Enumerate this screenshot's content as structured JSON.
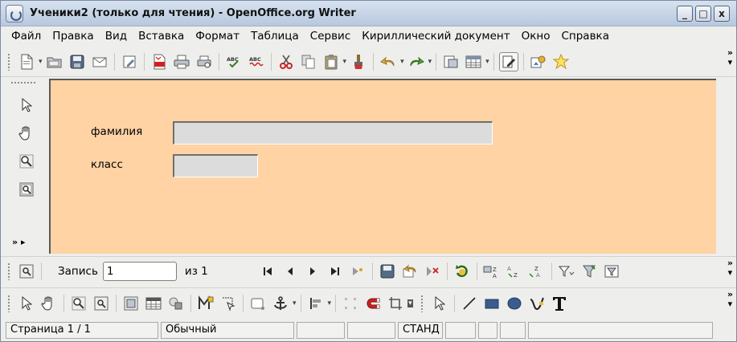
{
  "window": {
    "title": "Ученики2 (только для чтения) - OpenOffice.org Writer",
    "buttons": {
      "minimize": "_",
      "maximize": "□",
      "close": "x"
    }
  },
  "menu": [
    "Файл",
    "Правка",
    "Вид",
    "Вставка",
    "Формат",
    "Таблица",
    "Сервис",
    "Кириллический документ",
    "Окно",
    "Справка"
  ],
  "toolbar_main": {
    "icons": [
      "new-document-icon",
      "open-folder-icon",
      "save-icon",
      "email-icon",
      "edit-file-icon",
      "export-pdf-icon",
      "print-icon",
      "print-preview-icon",
      "spellcheck-icon",
      "autospellcheck-icon",
      "cut-icon",
      "copy-icon",
      "paste-icon",
      "format-paintbrush-icon",
      "undo-icon",
      "redo-icon",
      "navigator-icon",
      "table-icon",
      "draw-functions-icon",
      "gallery-icon",
      "star-icon"
    ],
    "more": "»"
  },
  "form": {
    "fields": [
      {
        "label": "фамилия",
        "value": ""
      },
      {
        "label": "класс",
        "value": ""
      }
    ]
  },
  "form_toolbar": {
    "icons": [
      "select-arrow-icon",
      "hand-icon",
      "zoom-icon",
      "form-zoom-icon"
    ],
    "more": "»"
  },
  "record_nav": {
    "record_label": "Запись",
    "record_value": "1",
    "of_label": "из 1",
    "icons": [
      "first-record-icon",
      "prev-record-icon",
      "next-record-icon",
      "last-record-icon",
      "new-record-icon",
      "save-record-icon",
      "undo-record-icon",
      "delete-record-icon",
      "refresh-icon",
      "sort-ascending-icon",
      "sort-descending-icon",
      "sort-icon",
      "autofilter-icon",
      "apply-filter-icon",
      "standard-filter-icon"
    ],
    "more": "»"
  },
  "toolbar_draw": {
    "icons": [
      "select-icon",
      "hand-icon",
      "zoom-icon",
      "form-zoom-icon",
      "picture-icon",
      "table-icon",
      "group-icon",
      "wrap-icon",
      "contour-icon",
      "frame-icon",
      "anchor-icon",
      "align-icon",
      "points-icon",
      "magnet-icon",
      "crop-icon",
      "select-arrow-icon",
      "line-icon",
      "rectangle-icon",
      "ellipse-icon",
      "curve-icon",
      "text-icon"
    ],
    "more": "»"
  },
  "status": {
    "page": "Страница  1 / 1",
    "style": "Обычный",
    "mode": "СТАНД"
  },
  "colors": {
    "document_background": "#ffd3a4",
    "field_background": "#dcdcdc",
    "title_bar": "#c4d3e6"
  }
}
